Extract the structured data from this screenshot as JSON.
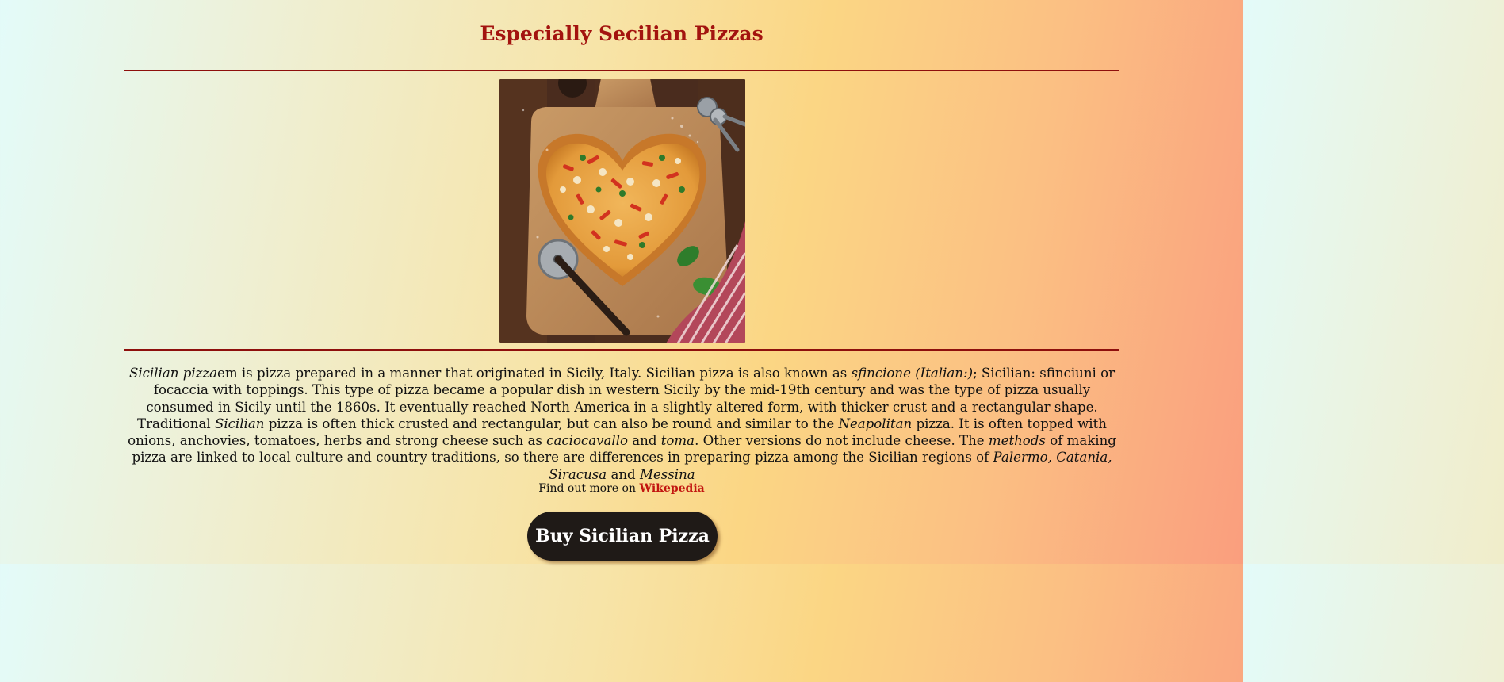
{
  "header": {
    "title": "Especially Secilian Pizzas"
  },
  "image": {
    "icon": "heart-shaped-pizza-photo"
  },
  "description": {
    "seg1": "Sicilian pizza",
    "seg2": "em is pizza prepared in a manner that originated in Sicily, Italy. Sicilian pizza is also known as ",
    "seg3": "sfincione (Italian:)",
    "seg4": "; Sicilian: sfinciuni or focaccia with toppings. This type of pizza became a popular dish in western Sicily by the mid-19th century and was the type of pizza usually consumed in Sicily until the 1860s. It eventually reached North America in a slightly altered form, with thicker crust and a rectangular shape. Traditional ",
    "seg5": "Sicilian",
    "seg6": " pizza is often thick crusted and rectangular, but can also be round and similar to the ",
    "seg7": "Neapolitan",
    "seg8": " pizza. It is often topped with onions, anchovies, tomatoes, herbs and strong cheese such as ",
    "seg9": "caciocavallo",
    "seg10": " and ",
    "seg11": "toma",
    "seg12": ". Other versions do not include cheese. The ",
    "seg13": "methods",
    "seg14": " of making pizza are linked to local culture and country traditions, so there are differences in preparing pizza among the Sicilian regions of ",
    "seg15": "Palermo, Catania, Siracusa",
    "seg16": " and ",
    "seg17": "Messina"
  },
  "find_more": {
    "prefix": "Find out more on ",
    "link_label": "Wikepedia"
  },
  "cta": {
    "label": "Buy Sicilian Pizza"
  },
  "colors": {
    "title": "#a3130f",
    "divider": "#8e0f0c",
    "link": "#c21510",
    "button_bg": "#1f1a17"
  }
}
